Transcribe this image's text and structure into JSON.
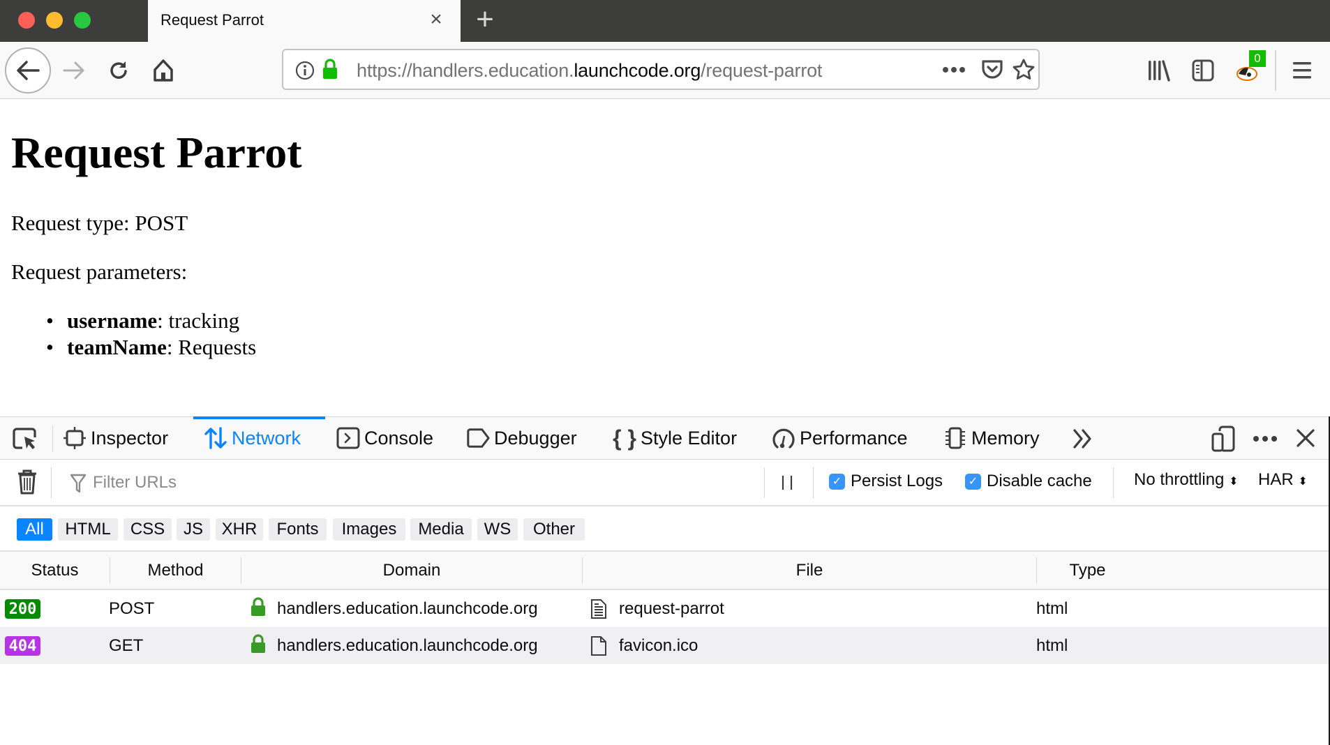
{
  "window": {
    "traffic_lights": {
      "close": "#fe5f57",
      "minimize": "#febc2e",
      "zoom": "#28c840"
    }
  },
  "tab": {
    "title": "Request Parrot",
    "close_icon": "×",
    "new_tab_icon": "+"
  },
  "navbar": {
    "url_scheme": "https://handlers.education.",
    "url_host": "launchcode.org",
    "url_path": "/request-parrot",
    "extension_badge": "0"
  },
  "page": {
    "title": "Request Parrot",
    "request_type_label": "Request type: POST",
    "params_label": "Request parameters:",
    "params": [
      {
        "name": "username",
        "value": ": tracking"
      },
      {
        "name": "teamName",
        "value": ": Requests"
      }
    ]
  },
  "devtools": {
    "tabs": [
      {
        "label": "Inspector"
      },
      {
        "label": "Network"
      },
      {
        "label": "Console"
      },
      {
        "label": "Debugger"
      },
      {
        "label": "Style Editor"
      },
      {
        "label": "Performance"
      },
      {
        "label": "Memory"
      }
    ],
    "selected_tab": "Network",
    "accent": "#0a84ff",
    "filter_placeholder": "Filter URLs",
    "persist_logs": {
      "label": "Persist Logs",
      "checked": true
    },
    "disable_cache": {
      "label": "Disable cache",
      "checked": true
    },
    "throttling": "No throttling",
    "har": "HAR",
    "type_filters": [
      "All",
      "HTML",
      "CSS",
      "JS",
      "XHR",
      "Fonts",
      "Images",
      "Media",
      "WS",
      "Other"
    ],
    "active_type_filter": "All",
    "columns": [
      "Status",
      "Method",
      "Domain",
      "File",
      "Type"
    ],
    "requests": [
      {
        "status": "200",
        "status_color": "#058b00",
        "method": "POST",
        "domain": "handlers.education.launchcode.org",
        "file": "request-parrot",
        "type": "html"
      },
      {
        "status": "404",
        "status_color": "#b733e6",
        "method": "GET",
        "domain": "handlers.education.launchcode.org",
        "file": "favicon.ico",
        "type": "html"
      }
    ]
  }
}
